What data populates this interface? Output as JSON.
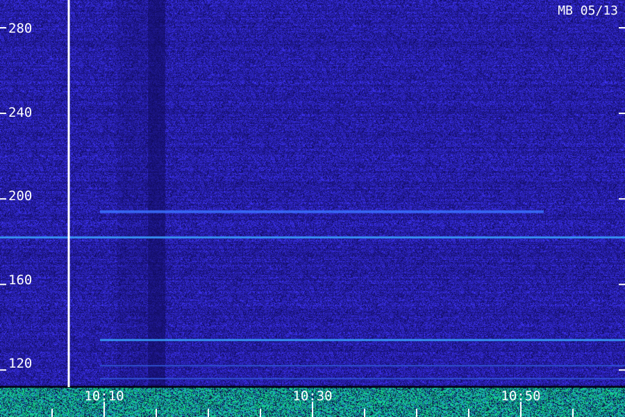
{
  "station_label": "MB 05/13",
  "colors": {
    "background": "#14106e",
    "noise_low": "#1a1490",
    "noise_high": "#3a34d8",
    "echo": "#3aa0ff",
    "strong_echo": "#5fe0ff",
    "bottom_band": "#20c060",
    "marker": "#ffffff",
    "text": "#ffffff"
  },
  "chart_data": {
    "type": "heatmap",
    "title": "MB 05/13",
    "ylim": [
      112,
      293
    ],
    "xlim": [
      10.0,
      11.0
    ],
    "y_tick_labels": [
      "280",
      "240",
      "200",
      "160",
      "120"
    ],
    "y_ticks": [
      280,
      240,
      200,
      160,
      120
    ],
    "x_tick_labels": [
      "10:10",
      "10:30",
      "10:50"
    ],
    "x_ticks": [
      10.1,
      10.3,
      10.5
    ],
    "grid": false,
    "colormap": "dark-blue to cyan to green",
    "marker_time": 10.11,
    "horizontal_traces": [
      {
        "y": 182,
        "x_start": 10.0,
        "x_end": 11.0,
        "intensity": "strong"
      },
      {
        "y": 194,
        "x_start": 10.16,
        "x_end": 10.87,
        "intensity": "medium"
      },
      {
        "y": 134,
        "x_start": 10.16,
        "x_end": 11.0,
        "intensity": "strong"
      },
      {
        "y": 122,
        "x_start": 10.16,
        "x_end": 11.0,
        "intensity": "weak"
      },
      {
        "y": 116,
        "x_start": 10.16,
        "x_end": 11.0,
        "intensity": "weak"
      }
    ]
  }
}
